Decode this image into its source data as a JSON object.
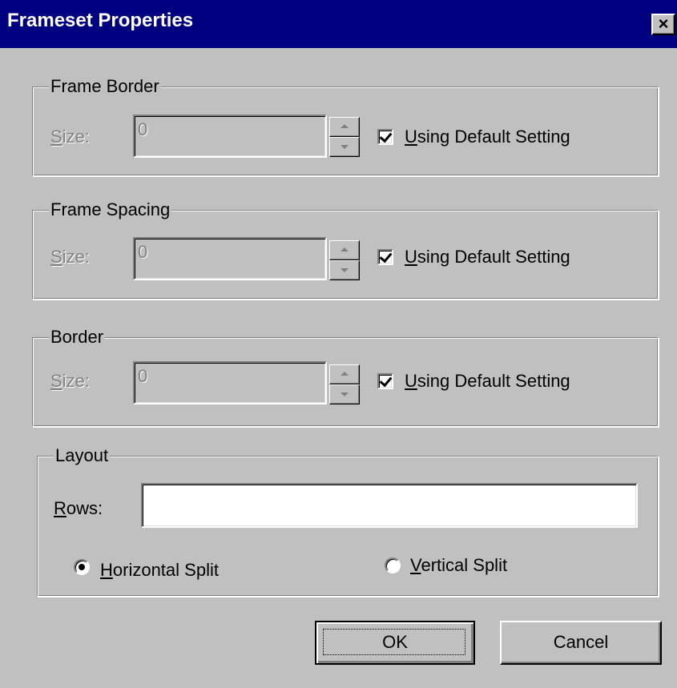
{
  "window": {
    "title": "Frameset Properties",
    "close_label": "×"
  },
  "frame_border": {
    "legend": "Frame Border",
    "size_label_u": "S",
    "size_label_rest": "ize:",
    "size_value": "0",
    "checkbox_checked": true,
    "checkbox_label_u": "U",
    "checkbox_label_rest": "sing Default Setting"
  },
  "frame_spacing": {
    "legend": "Frame Spacing",
    "size_label_u": "S",
    "size_label_rest": "ize:",
    "size_value": "0",
    "checkbox_checked": true,
    "checkbox_label_u": "U",
    "checkbox_label_rest": "sing Default Setting"
  },
  "border": {
    "legend": "Border",
    "size_label_u": "S",
    "size_label_rest": "ize:",
    "size_value": "0",
    "checkbox_checked": true,
    "checkbox_label_u": "U",
    "checkbox_label_rest": "sing Default Setting"
  },
  "layout": {
    "legend": "Layout",
    "rows_label_u": "R",
    "rows_label_rest": "ows:",
    "rows_value": "",
    "horizontal_label_u": "H",
    "horizontal_label_rest": "orizontal Split",
    "horizontal_selected": true,
    "vertical_label_u": "V",
    "vertical_label_rest": "ertical Split",
    "vertical_selected": false
  },
  "buttons": {
    "ok_label": "OK",
    "cancel_label": "Cancel"
  },
  "colors": {
    "titlebar": "#000080",
    "face": "#c0c0c0",
    "disabled_text": "#808080"
  }
}
